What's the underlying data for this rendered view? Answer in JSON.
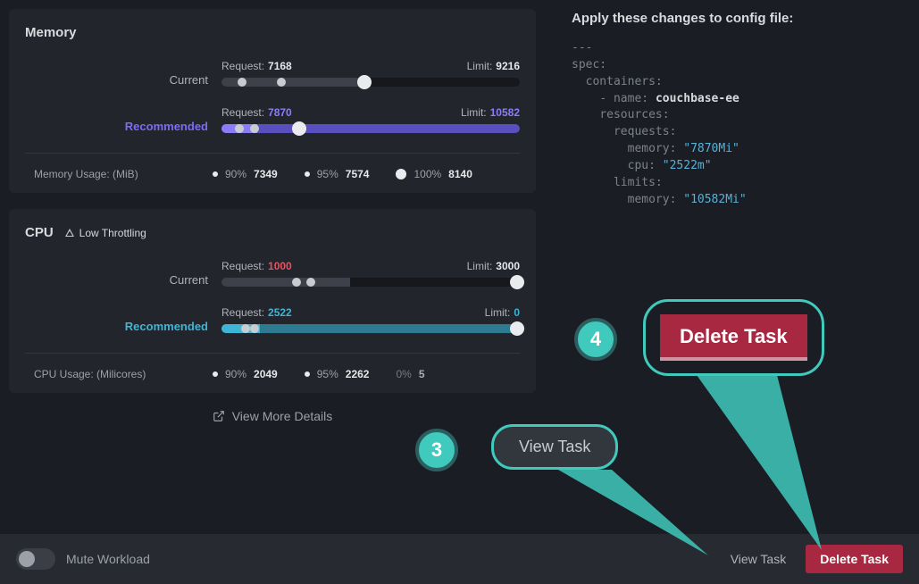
{
  "memory": {
    "title": "Memory",
    "current_label": "Current",
    "recommended_label": "Recommended",
    "req_label": "Request:",
    "lim_label": "Limit:",
    "current_request": "7168",
    "current_limit": "9216",
    "rec_request": "7870",
    "rec_limit": "10582",
    "usage_label": "Memory Usage: (MiB)",
    "p90_label": "90%",
    "p90_val": "7349",
    "p95_label": "95%",
    "p95_val": "7574",
    "p100_label": "100%",
    "p100_val": "8140"
  },
  "cpu": {
    "title": "CPU",
    "badge": "Low Throttling",
    "current_label": "Current",
    "recommended_label": "Recommended",
    "req_label": "Request:",
    "lim_label": "Limit:",
    "current_request": "1000",
    "current_limit": "3000",
    "rec_request": "2522",
    "rec_limit": "0",
    "usage_label": "CPU Usage: (Milicores)",
    "p90_label": "90%",
    "p90_val": "2049",
    "p95_label": "95%",
    "p95_val": "2262",
    "p100_label_partial": "0%",
    "p100_val_partial": "5"
  },
  "view_more": "View More Details",
  "config": {
    "title": "Apply these changes to config file:",
    "dashes": "---",
    "spec": "spec:",
    "containers": "containers:",
    "name_key": "- name:",
    "name_val": "couchbase-ee",
    "resources": "resources:",
    "requests": "requests:",
    "mem_key": "memory:",
    "mem_val": "\"7870Mi\"",
    "cpu_key": "cpu:",
    "cpu_val": "\"2522m\"",
    "limits": "limits:",
    "lim_mem_key": "memory:",
    "lim_mem_val": "\"10582Mi\""
  },
  "footer": {
    "mute": "Mute Workload",
    "view_task": "View Task",
    "delete_task": "Delete Task"
  },
  "callouts": {
    "c3": "3",
    "c3_label": "View Task",
    "c4": "4",
    "c4_label": "Delete Task"
  }
}
